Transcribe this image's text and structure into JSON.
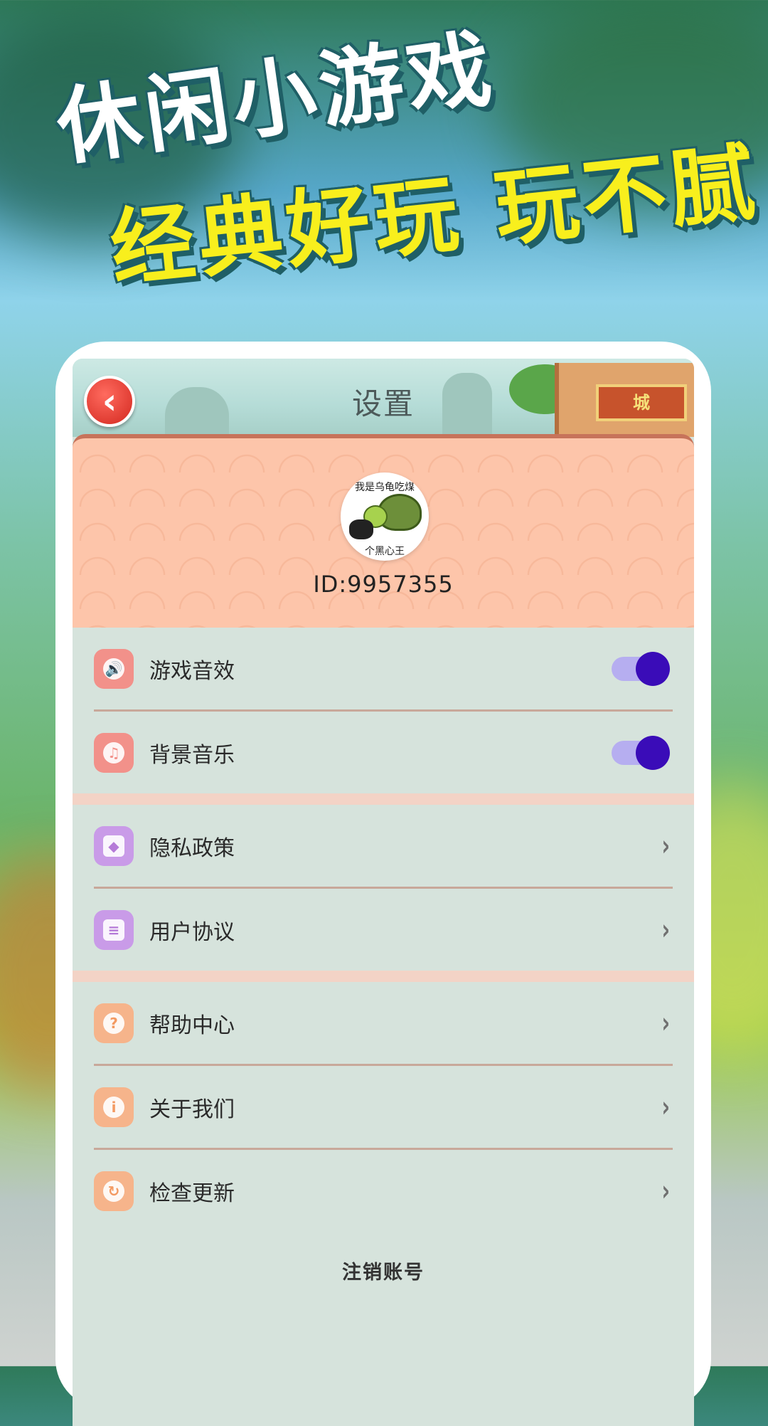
{
  "promo": {
    "line1": "休闲小游戏",
    "line2": "经典好玩 玩不腻"
  },
  "header": {
    "title": "设置",
    "back_icon": "chevron-left-icon",
    "sign_text": "城"
  },
  "profile": {
    "avatar_top_text": "我是乌龟吃煤",
    "avatar_bottom_text": "个黑心王",
    "user_id": "ID:9957355"
  },
  "groups": [
    {
      "items": [
        {
          "label": "游戏音效",
          "icon": "speaker-icon",
          "glyph": "🔊",
          "control": "toggle",
          "on": true
        },
        {
          "label": "背景音乐",
          "icon": "music-wave-icon",
          "glyph": "♫",
          "control": "toggle",
          "on": true
        }
      ]
    },
    {
      "items": [
        {
          "label": "隐私政策",
          "icon": "shield-icon",
          "glyph": "◆",
          "control": "chevron"
        },
        {
          "label": "用户协议",
          "icon": "document-icon",
          "glyph": "≡",
          "control": "chevron"
        }
      ]
    },
    {
      "items": [
        {
          "label": "帮助中心",
          "icon": "question-icon",
          "glyph": "?",
          "control": "chevron"
        },
        {
          "label": "关于我们",
          "icon": "info-icon",
          "glyph": "i",
          "control": "chevron"
        },
        {
          "label": "检查更新",
          "icon": "refresh-icon",
          "glyph": "↻",
          "control": "chevron"
        }
      ]
    }
  ],
  "footer": {
    "cancel_account": "注销账号"
  },
  "colors": {
    "toggle_knob": "#3a0cb8",
    "promo_yellow": "#f8ef1d",
    "back_button": "#d3281f"
  }
}
